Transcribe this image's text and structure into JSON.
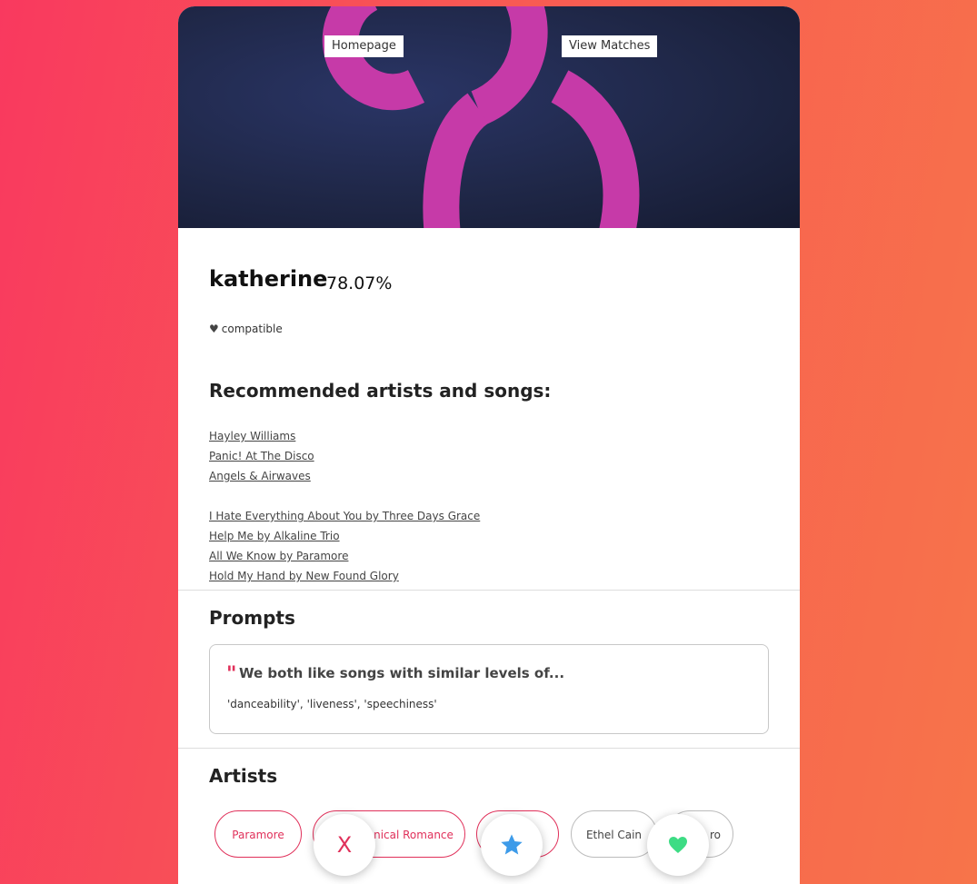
{
  "nav": {
    "homepage_label": "Homepage",
    "view_matches_label": "View Matches"
  },
  "profile": {
    "name": "katherine",
    "score": "78.07%",
    "compatibility": "compatible"
  },
  "recommendations": {
    "title": "Recommended artists and songs:",
    "artists": [
      "Hayley Williams",
      "Panic! At The Disco",
      "Angels & Airwaves"
    ],
    "songs": [
      "I Hate Everything About You by Three Days Grace",
      "Help Me by Alkaline Trio",
      "All We Know by Paramore",
      "Hold My Hand by New Found Glory"
    ]
  },
  "prompts": {
    "title": "Prompts",
    "question": "We both like songs with similar levels of...",
    "answer": "'danceability', 'liveness', 'speechiness'"
  },
  "artists_section": {
    "title": "Artists",
    "chips": [
      {
        "label": "Paramore",
        "shared": true
      },
      {
        "label": "nical Romance",
        "shared": true
      },
      {
        "label": "",
        "shared": true
      },
      {
        "label": "Ethel Cain",
        "shared": false
      },
      {
        "label": "ro",
        "shared": false
      }
    ]
  },
  "actions": {
    "dislike_label": "X",
    "dislike_icon": "x-icon",
    "superlike_icon": "star-icon",
    "like_icon": "heart-icon"
  },
  "colors": {
    "accent": "#e0305a",
    "star": "#3d9be9",
    "heart": "#3ddc84"
  }
}
